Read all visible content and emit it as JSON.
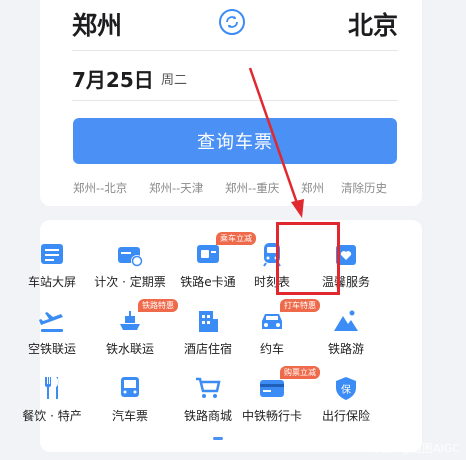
{
  "route": {
    "from": "郑州",
    "to": "北京"
  },
  "date": {
    "day": "7月25日",
    "weekday": "周二"
  },
  "search": {
    "button": "查询车票"
  },
  "history": [
    "郑州--北京",
    "郑州--天津",
    "郑州--重庆",
    "郑州",
    "清除历史"
  ],
  "grid": [
    {
      "label": "车站大屏",
      "icon": "station-screen-icon",
      "tag": ""
    },
    {
      "label": "计次 · 定期票",
      "icon": "ticket-card-icon",
      "tag": ""
    },
    {
      "label": "铁路e卡通",
      "icon": "e-card-icon",
      "tag": "乘车立减"
    },
    {
      "label": "时刻表",
      "icon": "train-icon",
      "tag": ""
    },
    {
      "label": "温馨服务",
      "icon": "heart-service-icon",
      "tag": ""
    },
    {
      "label": "空铁联运",
      "icon": "plane-train-icon",
      "tag": ""
    },
    {
      "label": "铁水联运",
      "icon": "ship-icon",
      "tag": "铁路特惠"
    },
    {
      "label": "酒店住宿",
      "icon": "hotel-icon",
      "tag": ""
    },
    {
      "label": "约车",
      "icon": "car-icon",
      "tag": "打车特惠"
    },
    {
      "label": "铁路游",
      "icon": "mountain-icon",
      "tag": ""
    },
    {
      "label": "餐饮 · 特产",
      "icon": "fork-knife-icon",
      "tag": ""
    },
    {
      "label": "汽车票",
      "icon": "bus-icon",
      "tag": ""
    },
    {
      "label": "铁路商城",
      "icon": "cart-icon",
      "tag": ""
    },
    {
      "label": "中铁畅行卡",
      "icon": "card-icon",
      "tag": "购票立减"
    },
    {
      "label": "出行保险",
      "icon": "insurance-icon",
      "tag": ""
    }
  ],
  "watermark": "头条 @追图AIGC",
  "colors": {
    "primary": "#4a90f5",
    "highlight": "#e0282e",
    "tag": "#ef6a4a"
  }
}
